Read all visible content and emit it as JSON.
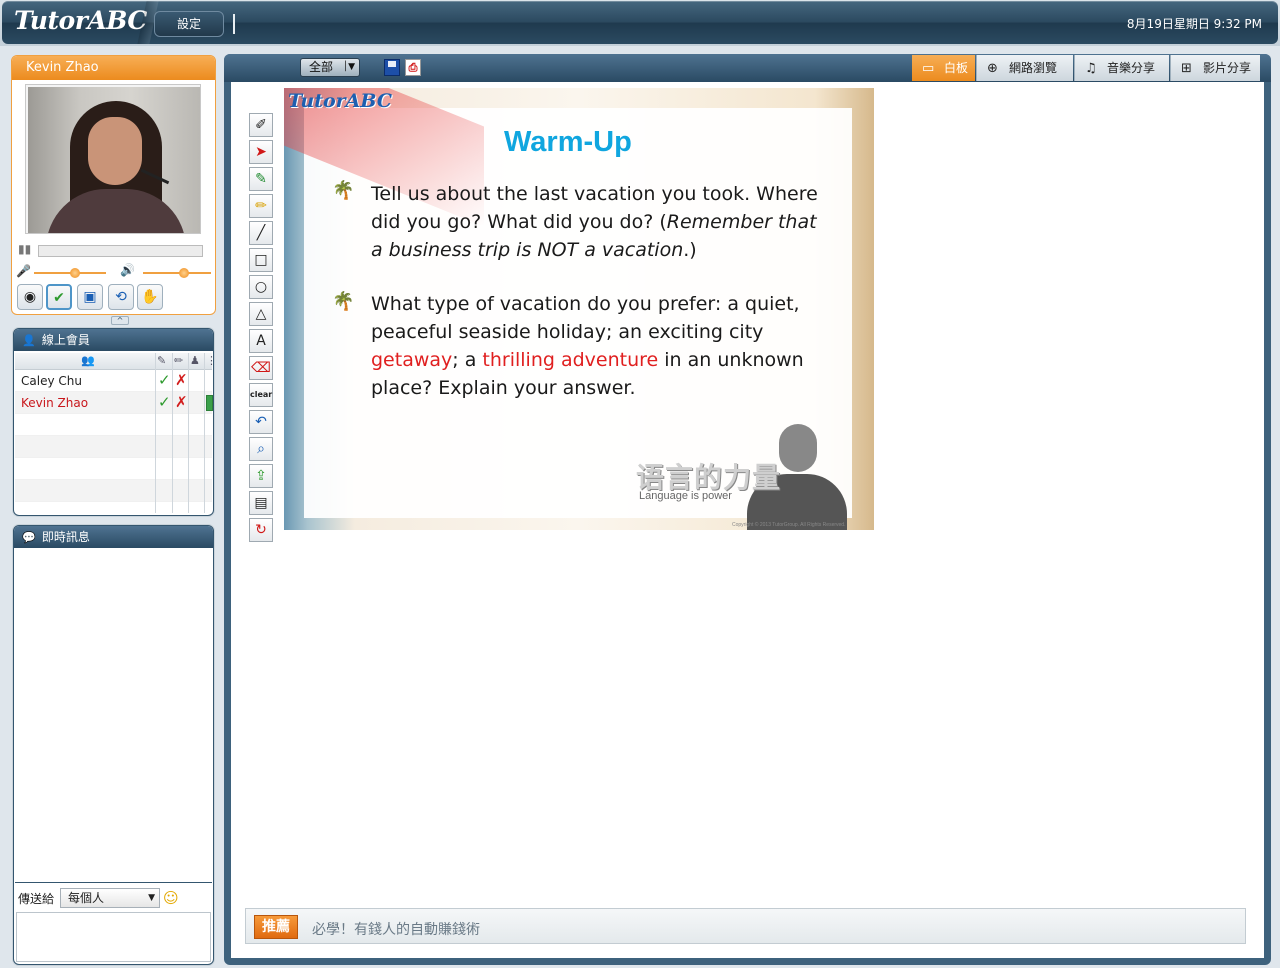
{
  "topbar": {
    "logo": "TutorABC",
    "settings_label": "設定",
    "datetime": "8月19日星期日 9:32 PM"
  },
  "user_panel": {
    "name": "Kevin Zhao",
    "controls": [
      {
        "icon": "webcam-icon"
      },
      {
        "icon": "checkbox-icon"
      },
      {
        "icon": "screen-share-stop-icon"
      },
      {
        "icon": "whiteboard-stop-icon"
      },
      {
        "icon": "raise-hand-icon"
      }
    ]
  },
  "members": {
    "title": "線上會員",
    "rows": [
      {
        "name": "Caley Chu",
        "color": "#222222",
        "mic": true,
        "draw": false,
        "speaking": false
      },
      {
        "name": "Kevin Zhao",
        "color": "#c8171c",
        "mic": true,
        "draw": false,
        "speaking": true
      }
    ]
  },
  "chat": {
    "title": "即時訊息",
    "send_to_label": "傳送給",
    "send_to_value": "每個人",
    "input_value": ""
  },
  "main": {
    "page_select": "全部",
    "tabs": [
      {
        "label": "白板",
        "icon": "whiteboard-icon",
        "active": true
      },
      {
        "label": "網路瀏覽",
        "icon": "globe-icon",
        "active": false
      },
      {
        "label": "音樂分享",
        "icon": "music-note-icon",
        "active": false
      },
      {
        "label": "影片分享",
        "icon": "video-grid-icon",
        "active": false
      }
    ],
    "tools": [
      "brush-settings-icon",
      "pointer-arrow-icon",
      "marker-icon",
      "highlighter-icon",
      "line-icon",
      "rectangle-icon",
      "circle-icon",
      "triangle-icon",
      "text-icon",
      "eraser-icon",
      "clear-icon",
      "undo-icon",
      "zoom-icon",
      "upload-image-icon",
      "document-icon",
      "refresh-icon"
    ],
    "clear_label": "clear"
  },
  "slide": {
    "logo": "TutorABC",
    "title": "Warm-Up",
    "bullet1": {
      "text": "Tell us about the last vacation you took. Where did you go? What did you do? (",
      "italic": "Remember that a business trip is NOT a vacation",
      "tail": ".)"
    },
    "bullet2": {
      "part1": "What type of vacation do you prefer: a quiet, peaceful seaside holiday; an exciting city ",
      "red1": "getaway",
      "part2": "; a ",
      "red2": "thrilling adventure",
      "part3": " in an unknown place? Explain your answer."
    },
    "slogan_cn": "语言的力量",
    "slogan_en": "Language is power",
    "copyright": "Copyright © 2013 TutorGroup. All Rights Reserved."
  },
  "recommend": {
    "badge": "推薦",
    "text": "必學！有錢人的自動賺錢術"
  }
}
